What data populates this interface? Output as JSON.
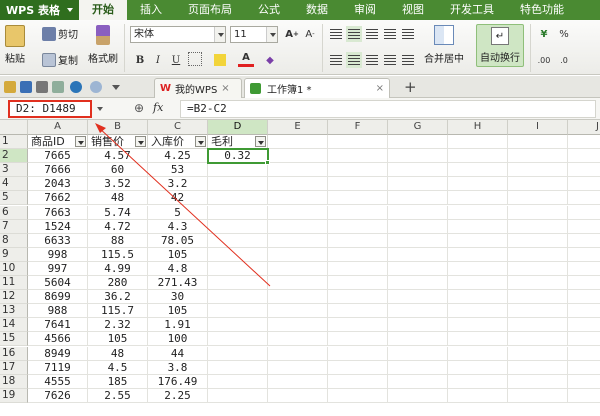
{
  "app": {
    "title": "WPS 表格"
  },
  "menu": {
    "items": [
      "开始",
      "插入",
      "页面布局",
      "公式",
      "数据",
      "审阅",
      "视图",
      "开发工具",
      "特色功能"
    ],
    "active_index": 0
  },
  "ribbon": {
    "cut_label": "剪切",
    "paste_label": "粘贴",
    "copy_label": "复制",
    "format_painter_label": "格式刷",
    "font_name": "宋体",
    "font_size": "11",
    "merge_label": "合并居中",
    "wrap_label": "自动换行",
    "bold": "B",
    "italic": "I",
    "underline": "U",
    "percent": "%"
  },
  "tabs": {
    "tab1": "我的WPS",
    "tab2": "工作簿1 *",
    "close_glyph": "×",
    "add_glyph": "+"
  },
  "formula_bar": {
    "name_box": "D2: D1489",
    "fx": "fx",
    "formula": "=B2-C2"
  },
  "sheet": {
    "columns": [
      "A",
      "B",
      "C",
      "D",
      "E",
      "F",
      "G",
      "H",
      "I",
      "J"
    ],
    "headers": [
      "商品ID",
      "销售价",
      "入库价",
      "毛利"
    ],
    "rows": [
      [
        "7665",
        "4.57",
        "4.25",
        "0.32"
      ],
      [
        "7666",
        "60",
        "53",
        ""
      ],
      [
        "2043",
        "3.52",
        "3.2",
        ""
      ],
      [
        "7662",
        "48",
        "42",
        ""
      ],
      [
        "7663",
        "5.74",
        "5",
        ""
      ],
      [
        "1524",
        "4.72",
        "4.3",
        ""
      ],
      [
        "6633",
        "88",
        "78.05",
        ""
      ],
      [
        "998",
        "115.5",
        "105",
        ""
      ],
      [
        "997",
        "4.99",
        "4.8",
        ""
      ],
      [
        "5604",
        "280",
        "271.43",
        ""
      ],
      [
        "8699",
        "36.2",
        "30",
        ""
      ],
      [
        "988",
        "115.7",
        "105",
        ""
      ],
      [
        "7641",
        "2.32",
        "1.91",
        ""
      ],
      [
        "4566",
        "105",
        "100",
        ""
      ],
      [
        "8949",
        "48",
        "44",
        ""
      ],
      [
        "7119",
        "4.5",
        "3.8",
        ""
      ],
      [
        "4555",
        "185",
        "176.49",
        ""
      ],
      [
        "7626",
        "2.55",
        "2.25",
        ""
      ]
    ],
    "row_numbers": [
      "1",
      "2",
      "3",
      "4",
      "5",
      "6",
      "7",
      "8",
      "9",
      "10",
      "11",
      "12",
      "13",
      "14",
      "15",
      "16",
      "17",
      "18",
      "19"
    ]
  },
  "colors": {
    "accent": "#4a8a32",
    "selection": "#3f9a34",
    "annotation": "#e1301f"
  }
}
